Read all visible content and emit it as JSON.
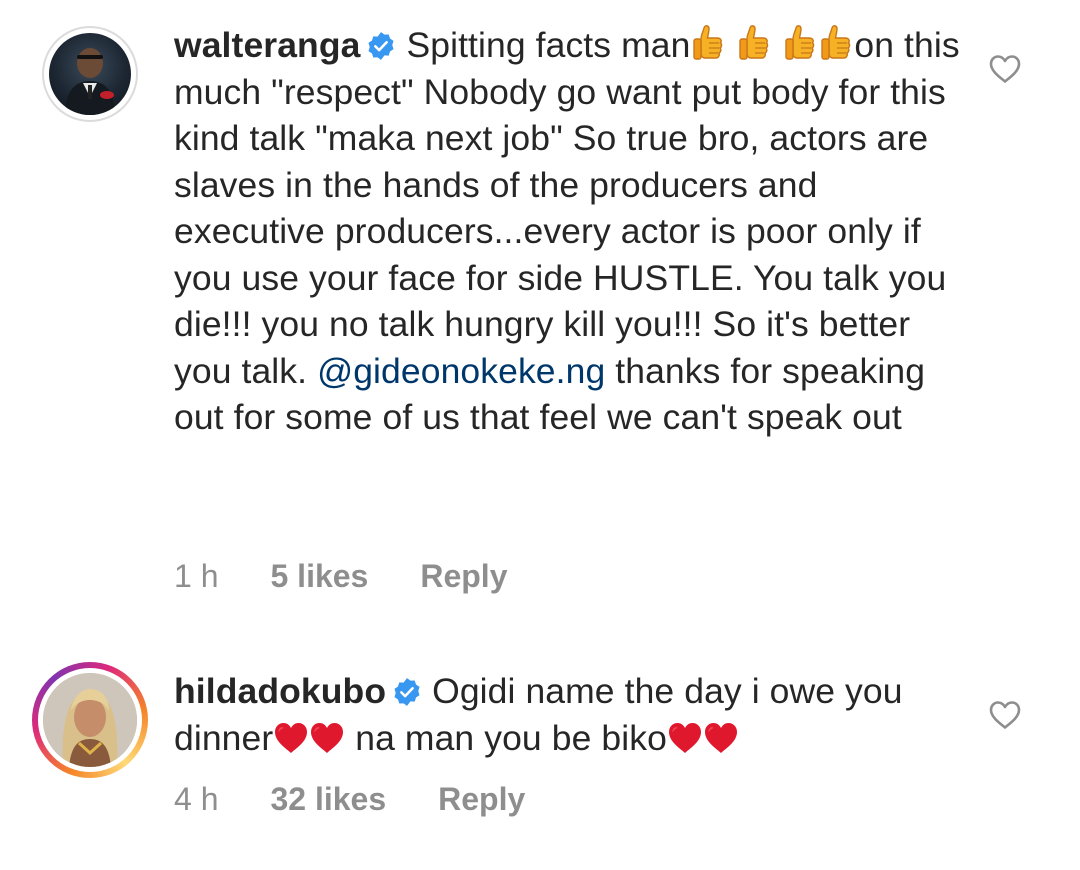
{
  "comments": [
    {
      "username": "walteranga",
      "verified": true,
      "text_parts": {
        "p1": "Spitting facts man",
        "p2": "on this much \"respect\" Nobody go want put body for this kind talk \"maka next job\" So true bro, actors are slaves in the hands of the producers and executive producers...every actor is poor only if you use your face for side HUSTLE. You talk you die!!! you no talk hungry kill you!!! So it's better you talk.",
        "mention": "@gideonokeke.ng",
        "p3": "thanks for speaking out for some of us that feel we can't speak out"
      },
      "emoji": [
        "thumbs-up",
        "thumbs-up",
        "thumbs-up",
        "thumbs-up"
      ],
      "time": "1 h",
      "likes": "5 likes",
      "reply": "Reply",
      "avatar_ring": "none"
    },
    {
      "username": "hildadokubo",
      "verified": true,
      "text_parts": {
        "p1": "Ogidi name the day i owe you dinner",
        "p2": "na man you be biko"
      },
      "emoji": [
        "red-heart",
        "red-heart",
        "red-heart",
        "red-heart"
      ],
      "time": "4 h",
      "likes": "32 likes",
      "reply": "Reply",
      "avatar_ring": "story-gradient"
    }
  ],
  "colors": {
    "text": "#262626",
    "secondary": "#8e8e8e",
    "mention": "#00376b",
    "verified_badge": "#3897f0",
    "heart_emoji": "#e0182d",
    "thumb_emoji": "#f7b125"
  },
  "icons": {
    "like": "heart-outline-icon",
    "verified": "verified-badge-icon"
  }
}
